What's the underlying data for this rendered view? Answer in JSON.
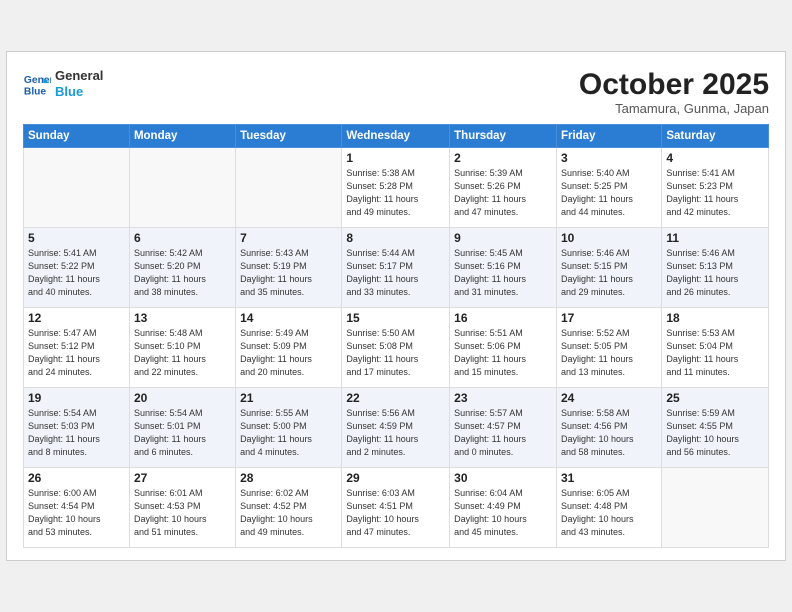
{
  "header": {
    "logo_line1": "General",
    "logo_line2": "Blue",
    "month": "October 2025",
    "location": "Tamamura, Gunma, Japan"
  },
  "weekdays": [
    "Sunday",
    "Monday",
    "Tuesday",
    "Wednesday",
    "Thursday",
    "Friday",
    "Saturday"
  ],
  "weeks": [
    {
      "shaded": false,
      "days": [
        {
          "num": "",
          "info": ""
        },
        {
          "num": "",
          "info": ""
        },
        {
          "num": "",
          "info": ""
        },
        {
          "num": "1",
          "info": "Sunrise: 5:38 AM\nSunset: 5:28 PM\nDaylight: 11 hours\nand 49 minutes."
        },
        {
          "num": "2",
          "info": "Sunrise: 5:39 AM\nSunset: 5:26 PM\nDaylight: 11 hours\nand 47 minutes."
        },
        {
          "num": "3",
          "info": "Sunrise: 5:40 AM\nSunset: 5:25 PM\nDaylight: 11 hours\nand 44 minutes."
        },
        {
          "num": "4",
          "info": "Sunrise: 5:41 AM\nSunset: 5:23 PM\nDaylight: 11 hours\nand 42 minutes."
        }
      ]
    },
    {
      "shaded": true,
      "days": [
        {
          "num": "5",
          "info": "Sunrise: 5:41 AM\nSunset: 5:22 PM\nDaylight: 11 hours\nand 40 minutes."
        },
        {
          "num": "6",
          "info": "Sunrise: 5:42 AM\nSunset: 5:20 PM\nDaylight: 11 hours\nand 38 minutes."
        },
        {
          "num": "7",
          "info": "Sunrise: 5:43 AM\nSunset: 5:19 PM\nDaylight: 11 hours\nand 35 minutes."
        },
        {
          "num": "8",
          "info": "Sunrise: 5:44 AM\nSunset: 5:17 PM\nDaylight: 11 hours\nand 33 minutes."
        },
        {
          "num": "9",
          "info": "Sunrise: 5:45 AM\nSunset: 5:16 PM\nDaylight: 11 hours\nand 31 minutes."
        },
        {
          "num": "10",
          "info": "Sunrise: 5:46 AM\nSunset: 5:15 PM\nDaylight: 11 hours\nand 29 minutes."
        },
        {
          "num": "11",
          "info": "Sunrise: 5:46 AM\nSunset: 5:13 PM\nDaylight: 11 hours\nand 26 minutes."
        }
      ]
    },
    {
      "shaded": false,
      "days": [
        {
          "num": "12",
          "info": "Sunrise: 5:47 AM\nSunset: 5:12 PM\nDaylight: 11 hours\nand 24 minutes."
        },
        {
          "num": "13",
          "info": "Sunrise: 5:48 AM\nSunset: 5:10 PM\nDaylight: 11 hours\nand 22 minutes."
        },
        {
          "num": "14",
          "info": "Sunrise: 5:49 AM\nSunset: 5:09 PM\nDaylight: 11 hours\nand 20 minutes."
        },
        {
          "num": "15",
          "info": "Sunrise: 5:50 AM\nSunset: 5:08 PM\nDaylight: 11 hours\nand 17 minutes."
        },
        {
          "num": "16",
          "info": "Sunrise: 5:51 AM\nSunset: 5:06 PM\nDaylight: 11 hours\nand 15 minutes."
        },
        {
          "num": "17",
          "info": "Sunrise: 5:52 AM\nSunset: 5:05 PM\nDaylight: 11 hours\nand 13 minutes."
        },
        {
          "num": "18",
          "info": "Sunrise: 5:53 AM\nSunset: 5:04 PM\nDaylight: 11 hours\nand 11 minutes."
        }
      ]
    },
    {
      "shaded": true,
      "days": [
        {
          "num": "19",
          "info": "Sunrise: 5:54 AM\nSunset: 5:03 PM\nDaylight: 11 hours\nand 8 minutes."
        },
        {
          "num": "20",
          "info": "Sunrise: 5:54 AM\nSunset: 5:01 PM\nDaylight: 11 hours\nand 6 minutes."
        },
        {
          "num": "21",
          "info": "Sunrise: 5:55 AM\nSunset: 5:00 PM\nDaylight: 11 hours\nand 4 minutes."
        },
        {
          "num": "22",
          "info": "Sunrise: 5:56 AM\nSunset: 4:59 PM\nDaylight: 11 hours\nand 2 minutes."
        },
        {
          "num": "23",
          "info": "Sunrise: 5:57 AM\nSunset: 4:57 PM\nDaylight: 11 hours\nand 0 minutes."
        },
        {
          "num": "24",
          "info": "Sunrise: 5:58 AM\nSunset: 4:56 PM\nDaylight: 10 hours\nand 58 minutes."
        },
        {
          "num": "25",
          "info": "Sunrise: 5:59 AM\nSunset: 4:55 PM\nDaylight: 10 hours\nand 56 minutes."
        }
      ]
    },
    {
      "shaded": false,
      "days": [
        {
          "num": "26",
          "info": "Sunrise: 6:00 AM\nSunset: 4:54 PM\nDaylight: 10 hours\nand 53 minutes."
        },
        {
          "num": "27",
          "info": "Sunrise: 6:01 AM\nSunset: 4:53 PM\nDaylight: 10 hours\nand 51 minutes."
        },
        {
          "num": "28",
          "info": "Sunrise: 6:02 AM\nSunset: 4:52 PM\nDaylight: 10 hours\nand 49 minutes."
        },
        {
          "num": "29",
          "info": "Sunrise: 6:03 AM\nSunset: 4:51 PM\nDaylight: 10 hours\nand 47 minutes."
        },
        {
          "num": "30",
          "info": "Sunrise: 6:04 AM\nSunset: 4:49 PM\nDaylight: 10 hours\nand 45 minutes."
        },
        {
          "num": "31",
          "info": "Sunrise: 6:05 AM\nSunset: 4:48 PM\nDaylight: 10 hours\nand 43 minutes."
        },
        {
          "num": "",
          "info": ""
        }
      ]
    }
  ]
}
